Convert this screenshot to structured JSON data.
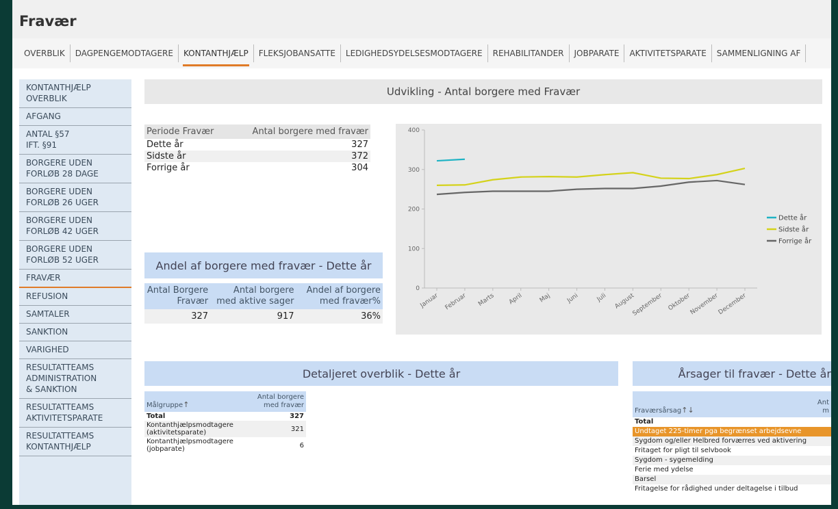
{
  "app": {
    "title": "Fravær"
  },
  "tabs": [
    {
      "label": "OVERBLIK"
    },
    {
      "label": "DAGPENGEMODTAGERE"
    },
    {
      "label": "KONTANTHJÆLP",
      "active": true
    },
    {
      "label": "FLEKSJOBANSATTE"
    },
    {
      "label": "LEDIGHEDSYDELSESMODTAGERE"
    },
    {
      "label": "REHABILITANDER"
    },
    {
      "label": "JOBPARATE"
    },
    {
      "label": "AKTIVITETSPARATE"
    },
    {
      "label": "SAMMENLIGNING AF"
    }
  ],
  "sidebar": {
    "items": [
      {
        "label": "KONTANTHJÆLP\nOVERBLIK"
      },
      {
        "label": "AFGANG"
      },
      {
        "label": "ANTAL §57\nIFT. §91"
      },
      {
        "label": "BORGERE UDEN\nFORLØB 28 DAGE"
      },
      {
        "label": "BORGERE UDEN\nFORLØB 26 UGER"
      },
      {
        "label": "BORGERE UDEN\nFORLØB 42 UGER"
      },
      {
        "label": "BORGERE UDEN\nFORLØB 52 UGER"
      },
      {
        "label": "FRAVÆR",
        "active": true
      },
      {
        "label": "REFUSION"
      },
      {
        "label": "SAMTALER"
      },
      {
        "label": "SANKTION"
      },
      {
        "label": "VARIGHED"
      },
      {
        "label": "RESULTATTEAMS\nADMINISTRATION\n& SANKTION"
      },
      {
        "label": "RESULTATTEAMS\nAKTIVITETSPARATE"
      },
      {
        "label": "RESULTATTEAMS\nKONTANTHJÆLP"
      }
    ]
  },
  "banners": {
    "udvikling": "Udvikling - Antal borgere med Fravær",
    "andel": "Andel af borgere med fravær - Dette år",
    "detaljeret": "Detaljeret overblik - Dette år",
    "aarsager": "Årsager til fravær - Dette år"
  },
  "period_table": {
    "headers": [
      "Periode Fravær",
      "Antal borgere med fravær"
    ],
    "rows": [
      [
        "Dette år",
        "327"
      ],
      [
        "Sidste år",
        "372"
      ],
      [
        "Forrige år",
        "304"
      ]
    ]
  },
  "andel_table": {
    "headers": [
      "Antal Borgere Fravær",
      "Antal borgere med aktive sager",
      "Andel af borgere med fravær%"
    ],
    "row": [
      "327",
      "917",
      "36%"
    ]
  },
  "detail_table": {
    "headers": [
      "Målgruppe",
      "Antal borgere med fravær"
    ],
    "rows": [
      [
        "Total",
        "327"
      ],
      [
        "Kontanthjælpsmodtagere (aktivitetsparate)",
        "321"
      ],
      [
        "Kontanthjælpsmodtagere (jobparate)",
        "6"
      ]
    ]
  },
  "aarsag_table": {
    "headers": [
      "Fraværsårsag",
      "Ant m"
    ],
    "rows": [
      "Total",
      "Undtaget 225-timer pga begrænset arbejdsevne",
      "Sygdom og/eller Helbred forværres ved aktivering",
      "Fritaget for pligt til selvbook",
      "Sygdom - sygemelding",
      "Ferie med ydelse",
      "Barsel",
      "Fritagelse for rådighed under deltagelse i tilbud"
    ]
  },
  "colors": {
    "dette_aar": "#1fb3c4",
    "sidste_aar": "#d4d21a",
    "forrige_aar": "#666666",
    "accent": "#e07b28"
  },
  "chart_data": {
    "type": "line",
    "categories": [
      "Januar",
      "Februar",
      "Marts",
      "April",
      "Maj",
      "Juni",
      "Juli",
      "August",
      "September",
      "Oktober",
      "November",
      "December"
    ],
    "ylim": [
      0,
      400
    ],
    "yticks": [
      0,
      100,
      200,
      300,
      400
    ],
    "legend_position": "right",
    "series": [
      {
        "name": "Dette år",
        "values": [
          322,
          326,
          null,
          null,
          null,
          null,
          null,
          null,
          null,
          null,
          null,
          null
        ]
      },
      {
        "name": "Sidste år",
        "values": [
          260,
          261,
          274,
          281,
          282,
          281,
          287,
          292,
          278,
          277,
          287,
          303
        ]
      },
      {
        "name": "Forrige år",
        "values": [
          237,
          242,
          245,
          245,
          245,
          250,
          252,
          252,
          258,
          268,
          272,
          262
        ]
      }
    ]
  }
}
